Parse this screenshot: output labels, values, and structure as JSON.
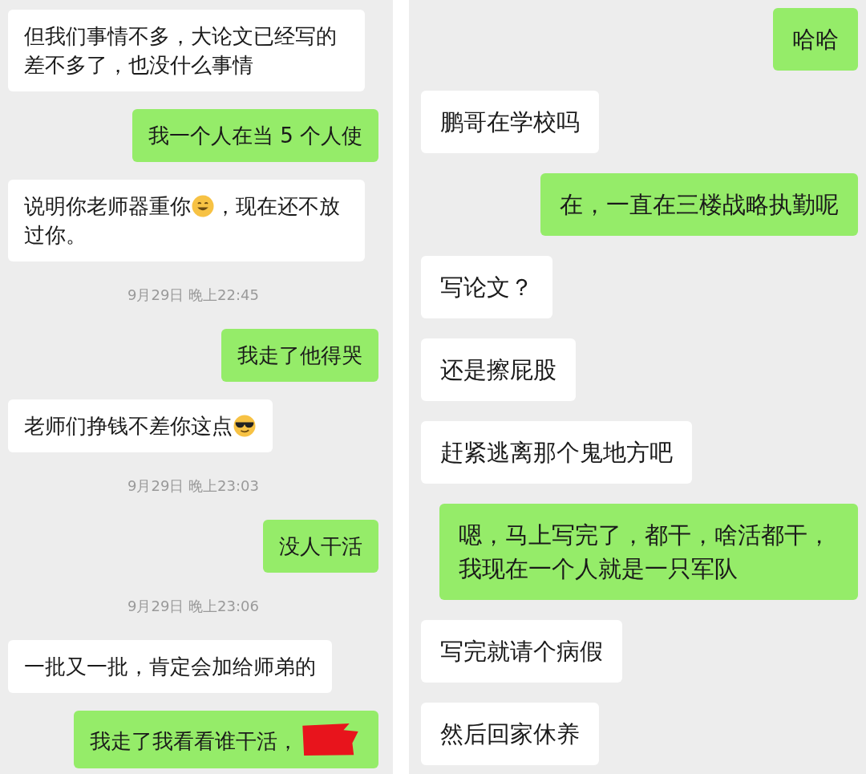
{
  "panels": [
    {
      "messages": [
        {
          "kind": "in",
          "text": "但我们事情不多，大论文已经写的差不多了，也没什么事情"
        },
        {
          "kind": "out",
          "text": "我一个人在当 5 个人使"
        },
        {
          "kind": "in",
          "text": "说明你老师器重你",
          "emoji": {
            "kind": "smile"
          },
          "text_after": "，现在还不放过你。"
        },
        {
          "kind": "time",
          "text": "9月29日 晚上22:45"
        },
        {
          "kind": "out",
          "text": "我走了他得哭"
        },
        {
          "kind": "in",
          "text": "老师们挣钱不差你这点",
          "emoji": {
            "kind": "cool"
          }
        },
        {
          "kind": "time",
          "text": "9月29日 晚上23:03"
        },
        {
          "kind": "out",
          "text": "没人干活"
        },
        {
          "kind": "time",
          "text": "9月29日 晚上23:06"
        },
        {
          "kind": "in",
          "text": "一批又一批，肯定会加给师弟的"
        },
        {
          "kind": "out",
          "text": "我走了我看看谁干活，",
          "redacted": true
        }
      ]
    },
    {
      "messages": [
        {
          "kind": "out",
          "text": "哈哈"
        },
        {
          "kind": "in",
          "text": "鹏哥在学校吗"
        },
        {
          "kind": "out",
          "text": "在，一直在三楼战略执勤呢"
        },
        {
          "kind": "in",
          "text": "写论文？"
        },
        {
          "kind": "in",
          "text": "还是擦屁股"
        },
        {
          "kind": "in",
          "text": "赶紧逃离那个鬼地方吧"
        },
        {
          "kind": "out",
          "text": "嗯，马上写完了，都干，啥活都干，我现在一个人就是一只军队"
        },
        {
          "kind": "in",
          "text": "写完就请个病假"
        },
        {
          "kind": "in",
          "text": "然后回家休养"
        }
      ]
    }
  ]
}
